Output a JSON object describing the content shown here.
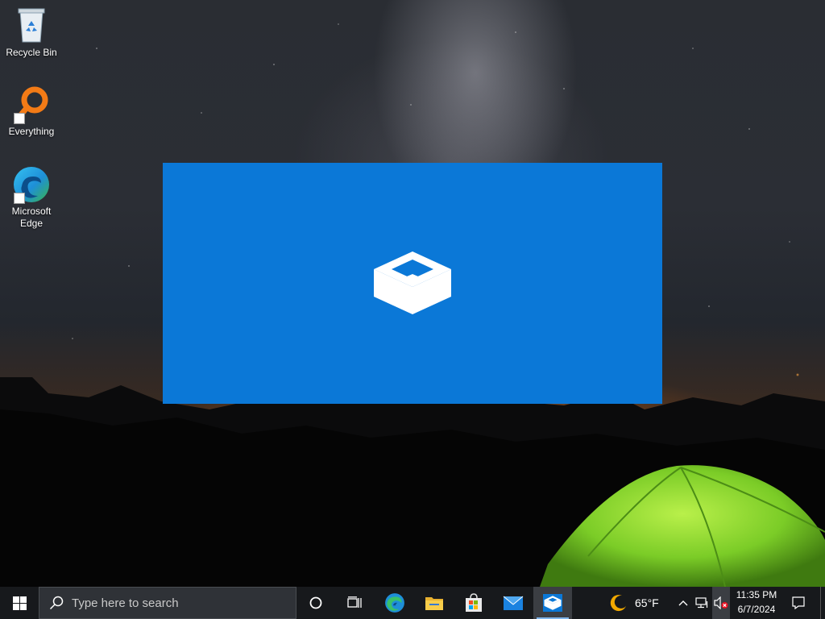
{
  "desktop": {
    "icons": [
      {
        "label": "Recycle Bin",
        "icon": "recycle-bin-icon"
      },
      {
        "label": "Everything",
        "icon": "everything-search-icon"
      },
      {
        "label": "Microsoft Edge",
        "icon": "edge-icon"
      }
    ]
  },
  "splash": {
    "app_icon": "windows-sandbox-icon",
    "background_color": "#0b78d7"
  },
  "taskbar": {
    "start_icon": "windows-start-icon",
    "search": {
      "placeholder": "Type here to search"
    },
    "pinned": [
      {
        "name": "cortana-icon"
      },
      {
        "name": "task-view-icon"
      },
      {
        "name": "edge-icon"
      },
      {
        "name": "file-explorer-icon"
      },
      {
        "name": "microsoft-store-icon"
      },
      {
        "name": "mail-icon"
      },
      {
        "name": "windows-sandbox-icon",
        "active": true
      }
    ],
    "weather": {
      "temp": "65°F",
      "icon": "moon-weather-icon"
    },
    "tray": {
      "chevron_icon": "chevron-up-icon",
      "network_icon": "network-icon",
      "volume_icon": "volume-muted-icon"
    },
    "clock": {
      "time": "11:35 PM",
      "date": "6/7/2024"
    },
    "notification_icon": "action-center-icon"
  }
}
